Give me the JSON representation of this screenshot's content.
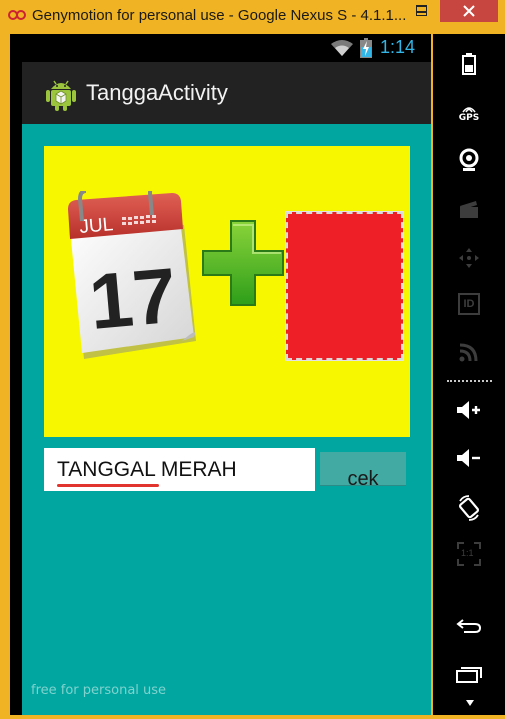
{
  "window": {
    "title": "Genymotion for personal use - Google Nexus S - 4.1.1...",
    "buttons": [
      "minimize",
      "maximize",
      "close"
    ]
  },
  "statusbar": {
    "time": "1:14"
  },
  "actionbar": {
    "title": "TanggaActivity"
  },
  "content": {
    "calendar": {
      "month": "JUL",
      "day": "17"
    },
    "input": {
      "value": "TANGGAL MERAH"
    },
    "button": {
      "label": "cek"
    },
    "watermark": "free for personal use"
  },
  "toolbar": {
    "gps_label": "GPS",
    "id_label": "ID",
    "ratio_label": "1:1",
    "icons": [
      "battery-icon",
      "gps-icon",
      "camera-icon",
      "video-icon",
      "dpad-icon",
      "id-icon",
      "rss-icon",
      "volume-up-icon",
      "volume-down-icon",
      "rotate-icon",
      "scale-icon",
      "back-icon",
      "recent-apps-icon"
    ]
  },
  "colors": {
    "frame": "#f0b323",
    "content_bg": "#02a6a1",
    "panel_bg": "#f7f800",
    "red_box": "#ee1f26",
    "clock": "#33b5e5",
    "button_bg": "#43a9a3"
  }
}
